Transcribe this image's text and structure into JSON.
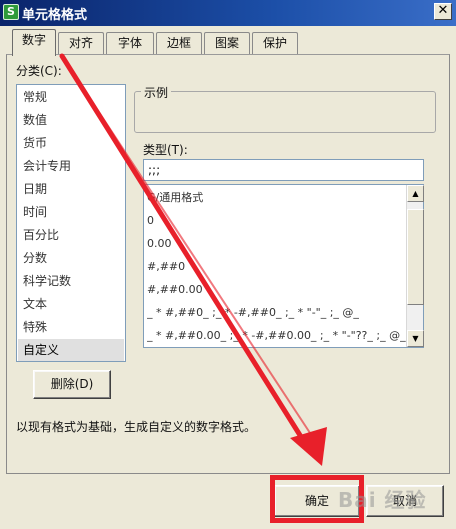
{
  "window": {
    "title": "单元格格式",
    "app_icon_letter": "S",
    "close_label": "✕"
  },
  "tabs": [
    {
      "label": "数字",
      "active": true
    },
    {
      "label": "对齐"
    },
    {
      "label": "字体"
    },
    {
      "label": "边框"
    },
    {
      "label": "图案"
    },
    {
      "label": "保护"
    }
  ],
  "category": {
    "label": "分类(C):",
    "items": [
      "常规",
      "数值",
      "货币",
      "会计专用",
      "日期",
      "时间",
      "百分比",
      "分数",
      "科学记数",
      "文本",
      "特殊",
      "自定义"
    ],
    "selected": "自定义"
  },
  "sample": {
    "legend": "示例",
    "value": ""
  },
  "type_field": {
    "label": "类型(T):",
    "value": ";;;"
  },
  "formats": [
    "G/通用格式",
    "0",
    "0.00",
    "#,##0",
    "#,##0.00",
    "_ * #,##0_ ;_ * -#,##0_ ;_ * \"-\"_ ;_ @_",
    "_ * #,##0.00_ ;_ * -#,##0.00_ ;_ * \"-\"??_ ;_ @_"
  ],
  "scrollbar": {
    "up_icon": "▲",
    "down_icon": "▼"
  },
  "buttons": {
    "delete": "删除(D)",
    "ok": "确定",
    "cancel": "取消"
  },
  "description": "以现有格式为基础，生成自定义的数字格式。",
  "annotation": {
    "color": "#e8202a",
    "watermark": "Bai 经验"
  }
}
